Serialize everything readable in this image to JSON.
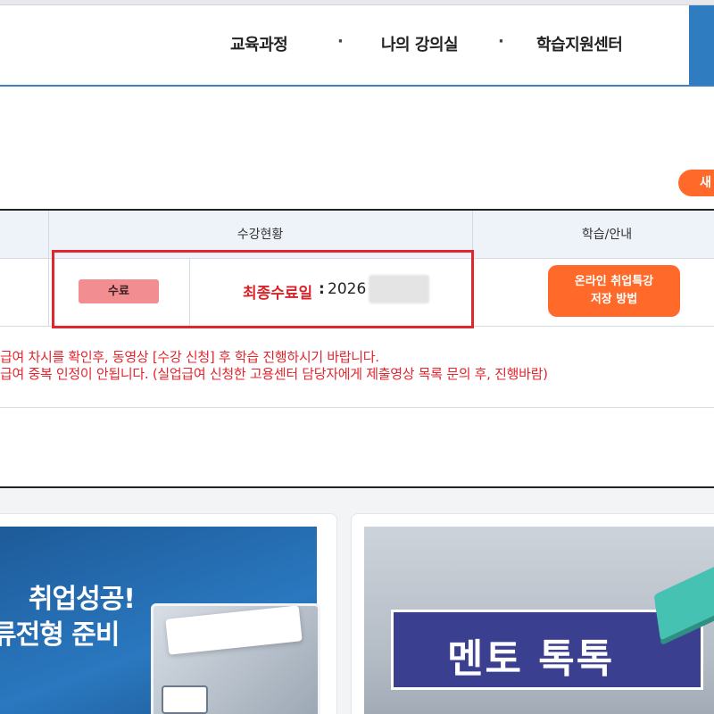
{
  "header": {
    "nav": [
      {
        "label": "교육과정"
      },
      {
        "label": "나의 강의실"
      },
      {
        "label": "학습지원센터"
      }
    ],
    "separator": "·"
  },
  "new_button_label": "새",
  "table": {
    "headers": {
      "status": "수강현황",
      "guide": "학습/안내"
    },
    "row": {
      "status_badge": "수료",
      "final_label": "최종수료일",
      "final_colon": ":",
      "final_value": "2026",
      "guide_button": {
        "line1": "온라인 취업특강",
        "line2": "저장 방법"
      }
    }
  },
  "notices": [
    "급여 차시를 확인후, 동영상 [수강 신청] 후 학습 진행하시기 바랍니다.",
    "급여 중복 인정이 안됩니다. (실업급여 신청한 고용센터 담당자에게 제출영상 목록 문의 후, 진행바람)"
  ],
  "banners": {
    "left": {
      "title": "취업성공!",
      "subtitle": "류전형 준비"
    },
    "right": {
      "title": "멘토 톡톡"
    }
  },
  "colors": {
    "accent_orange": "#ff6a2b",
    "header_blue": "#2f7cc1",
    "notice_red": "#e0262e",
    "badge_pink": "#f28d92"
  }
}
